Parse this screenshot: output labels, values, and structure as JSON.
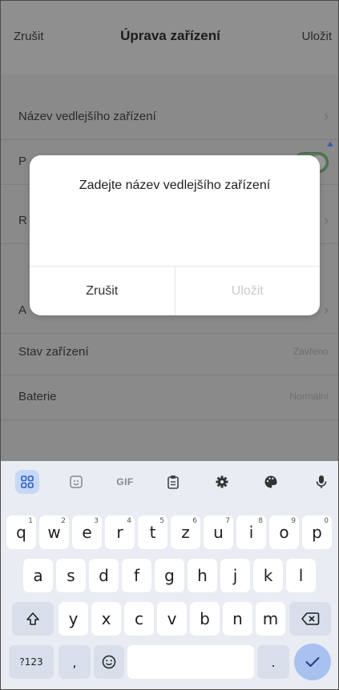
{
  "header": {
    "cancel_label": "Zrušit",
    "title": "Úprava zařízení",
    "save_label": "Uložit"
  },
  "settings": {
    "rows": [
      {
        "label": "Název vedlejšího zařízení",
        "value": ""
      },
      {
        "label": "P",
        "value": ""
      },
      {
        "label": "R",
        "value": ""
      },
      {
        "label": "A",
        "value": ""
      },
      {
        "label": "Stav zařízení",
        "value": "Zavřeno"
      },
      {
        "label": "Baterie",
        "value": "Normální"
      }
    ]
  },
  "dialog": {
    "title": "Zadejte název vedlejšího zařízení",
    "input_value": "",
    "cancel_label": "Zrušit",
    "save_label": "Uložit"
  },
  "keyboard": {
    "toolbar": {
      "gif_label": "GIF"
    },
    "row1": [
      {
        "k": "q",
        "n": "1"
      },
      {
        "k": "w",
        "n": "2"
      },
      {
        "k": "e",
        "n": "3"
      },
      {
        "k": "r",
        "n": "4"
      },
      {
        "k": "t",
        "n": "5"
      },
      {
        "k": "z",
        "n": "6"
      },
      {
        "k": "u",
        "n": "7"
      },
      {
        "k": "i",
        "n": "8"
      },
      {
        "k": "o",
        "n": "9"
      },
      {
        "k": "p",
        "n": "0"
      }
    ],
    "row2": [
      "a",
      "s",
      "d",
      "f",
      "g",
      "h",
      "j",
      "k",
      "l"
    ],
    "row3": [
      "y",
      "x",
      "c",
      "v",
      "b",
      "n",
      "m"
    ],
    "symbols_label": "?123",
    "comma_label": ",",
    "period_label": "."
  },
  "colors": {
    "dim_overlay": "#8c8c8c",
    "keyboard_bg": "#e9ecf2",
    "accent_blue": "#a9c1ef",
    "toggle_green": "#5e7d5e"
  }
}
